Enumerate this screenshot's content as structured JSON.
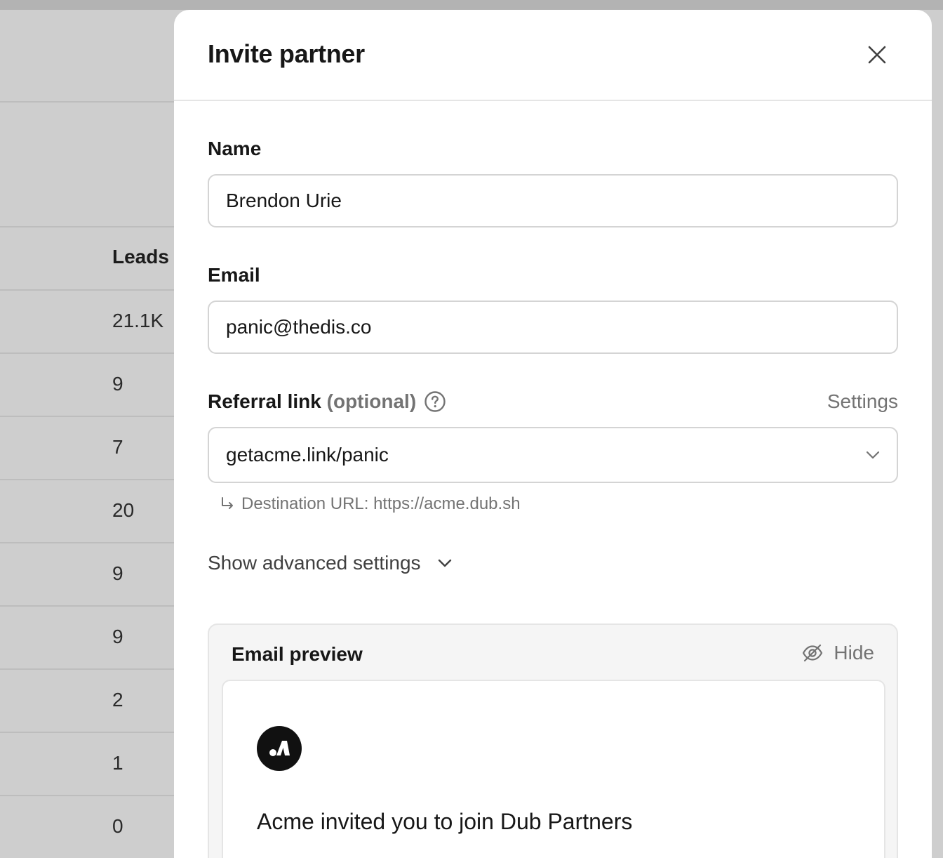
{
  "background_table": {
    "header": "Leads",
    "rows": [
      "21.1K",
      "9",
      "7",
      "20",
      "9",
      "9",
      "2",
      "1",
      "0"
    ]
  },
  "panel": {
    "title": "Invite partner",
    "close_icon": "close-icon"
  },
  "form": {
    "name": {
      "label": "Name",
      "value": "Brendon Urie"
    },
    "email": {
      "label": "Email",
      "value": "panic@thedis.co"
    },
    "referral": {
      "label": "Referral link",
      "optional": "(optional)",
      "help_icon": "question-circle-icon",
      "settings": "Settings",
      "value": "getacme.link/panic",
      "destination": "Destination URL: https://acme.dub.sh"
    },
    "advanced": "Show advanced settings"
  },
  "email_preview": {
    "title": "Email preview",
    "hide_label": "Hide",
    "hide_icon": "eye-off-icon",
    "heading": "Acme invited you to join Dub Partners"
  }
}
